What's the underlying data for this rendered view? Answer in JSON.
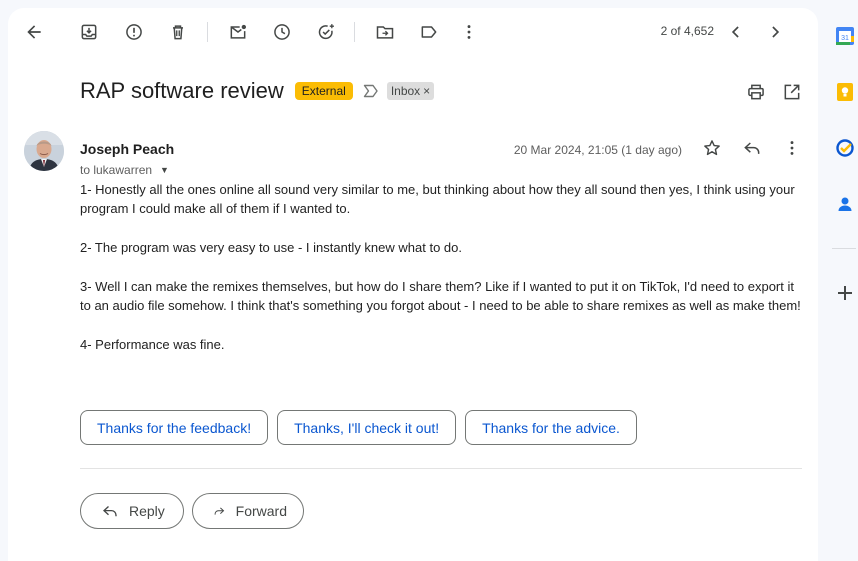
{
  "toolbar": {
    "icons": [
      "back-arrow-icon",
      "archive-icon",
      "report-spam-icon",
      "delete-icon",
      "mark-unread-icon",
      "snooze-icon",
      "add-task-icon",
      "move-to-icon",
      "label-icon",
      "more-vert-icon"
    ],
    "pager_text": "2 of 4,652"
  },
  "subject": {
    "title": "RAP software review",
    "external_badge": "External",
    "inbox_label": "Inbox",
    "inbox_remove": "×"
  },
  "message": {
    "sender": "Joseph Peach",
    "to_line": "to lukawarren",
    "caret": "▼",
    "date": "20 Mar 2024, 21:05 (1 day ago)",
    "body": [
      "1- Honestly all the ones online all sound very similar to me, but thinking about how they all sound then yes, I think using your program I could make all of them if I wanted to.",
      "2- The program was very easy to use - I instantly knew what to do.",
      "3- Well I can make the remixes themselves, but how do I share them? Like if I wanted to put it on TikTok, I'd need to export it to an audio file somehow. I think that's something you forgot about - I need to be able to share remixes as well as make them!",
      "4- Performance was fine."
    ]
  },
  "smart_replies": [
    "Thanks for the feedback!",
    "Thanks, I'll check it out!",
    "Thanks for the advice."
  ],
  "actions": {
    "reply": "Reply",
    "forward": "Forward"
  },
  "side_panel": {
    "calendar_day": "31"
  },
  "colors": {
    "external_badge": "#fbbc04",
    "smart_reply_text": "#0b57d0",
    "page_bg": "#f6f8fc"
  }
}
